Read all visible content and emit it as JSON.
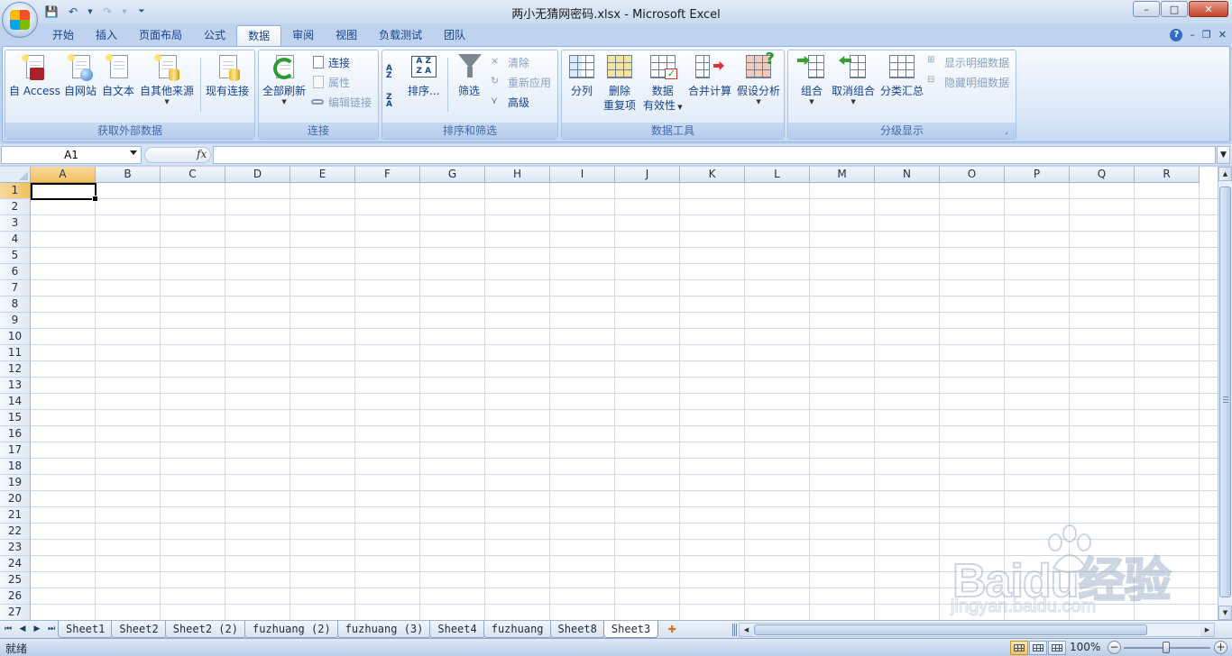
{
  "window": {
    "title": "两小无猜网密码.xlsx - Microsoft Excel",
    "controls": {
      "minimize": "–",
      "maximize": "□",
      "close": "✕"
    }
  },
  "qat": {
    "save_icon": "save-icon",
    "undo_icon": "undo-icon",
    "redo_icon": "redo-icon",
    "customize_icon": "customize-icon"
  },
  "ribbon_tabs": [
    "开始",
    "插入",
    "页面布局",
    "公式",
    "数据",
    "审阅",
    "视图",
    "负载测试",
    "团队"
  ],
  "active_tab": "数据",
  "ribbon": {
    "get_external": {
      "label": "获取外部数据",
      "access": "自 Access",
      "web": "自网站",
      "text": "自文本",
      "other": "自其他来源",
      "existing": "现有连接"
    },
    "connections": {
      "label": "连接",
      "refresh_all": "全部刷新",
      "connections": "连接",
      "properties": "属性",
      "edit_links": "编辑链接"
    },
    "sort_filter": {
      "label": "排序和筛选",
      "sort": "排序...",
      "filter": "筛选",
      "clear": "清除",
      "reapply": "重新应用",
      "advanced": "高级"
    },
    "data_tools": {
      "label": "数据工具",
      "text_to_columns": "分列",
      "remove_dup_1": "删除",
      "remove_dup_2": "重复项",
      "validation_1": "数据",
      "validation_2": "有效性",
      "consolidate": "合并计算",
      "whatif": "假设分析"
    },
    "outline": {
      "label": "分级显示",
      "group": "组合",
      "ungroup": "取消组合",
      "subtotal": "分类汇总",
      "show_detail": "显示明细数据",
      "hide_detail": "隐藏明细数据"
    }
  },
  "formula_bar": {
    "name_box": "A1",
    "fx": "fx",
    "value": ""
  },
  "columns": [
    "A",
    "B",
    "C",
    "D",
    "E",
    "F",
    "G",
    "H",
    "I",
    "J",
    "K",
    "L",
    "M",
    "N",
    "O",
    "P",
    "Q",
    "R"
  ],
  "rows": [
    "1",
    "2",
    "3",
    "4",
    "5",
    "6",
    "7",
    "8",
    "9",
    "10",
    "11",
    "12",
    "13",
    "14",
    "15",
    "16",
    "17",
    "18",
    "19",
    "20",
    "21",
    "22",
    "23",
    "24",
    "25",
    "26",
    "27"
  ],
  "active_cell": "A1",
  "sheet_tabs": [
    "Sheet1",
    "Sheet2",
    "Sheet2 (2)",
    "fuzhuang (2)",
    "fuzhuang (3)",
    "Sheet4",
    "fuzhuang",
    "Sheet8",
    "Sheet3"
  ],
  "active_sheet": "Sheet3",
  "status": {
    "text": "就绪",
    "zoom": "100%"
  },
  "watermark": {
    "text": "Baidu经验",
    "sub": "jingyan.baidu.com"
  },
  "colors": {
    "accent": "#15428b",
    "ribbon_bg": "#dbe8f8",
    "selected_header": "#f1c15f"
  }
}
